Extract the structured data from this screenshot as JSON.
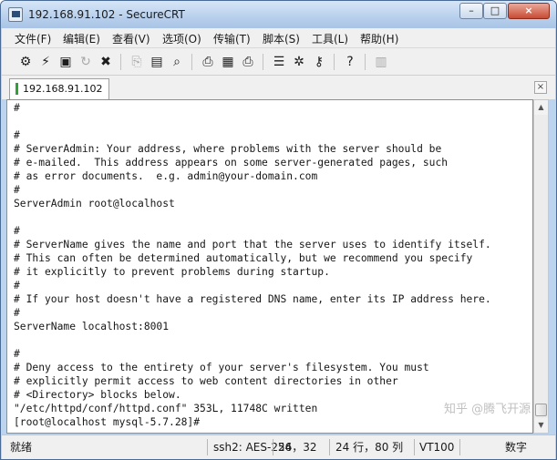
{
  "window": {
    "title": "192.168.91.102 - SecureCRT"
  },
  "menu": [
    "文件(F)",
    "编辑(E)",
    "查看(V)",
    "选项(O)",
    "传输(T)",
    "脚本(S)",
    "工具(L)",
    "帮助(H)"
  ],
  "toolbar": {
    "icons": [
      "connect-icon",
      "quick-connect-icon",
      "connect-tab-icon",
      "reconnect-icon",
      "disconnect-icon",
      "copy-icon",
      "paste-icon",
      "find-icon",
      "print-setup-icon",
      "print-selection-icon",
      "print-icon",
      "session-options-icon",
      "global-options-icon",
      "keymap-icon",
      "help-icon",
      "sftp-icon"
    ]
  },
  "tab": {
    "label": "192.168.91.102",
    "close_glyph": "×"
  },
  "terminal": {
    "lines": [
      "#",
      "",
      "#",
      "# ServerAdmin: Your address, where problems with the server should be",
      "# e-mailed.  This address appears on some server-generated pages, such",
      "# as error documents.  e.g. admin@your-domain.com",
      "#",
      "ServerAdmin root@localhost",
      "",
      "#",
      "# ServerName gives the name and port that the server uses to identify itself.",
      "# This can often be determined automatically, but we recommend you specify",
      "# it explicitly to prevent problems during startup.",
      "#",
      "# If your host doesn't have a registered DNS name, enter its IP address here.",
      "#",
      "ServerName localhost:8001",
      "",
      "#",
      "# Deny access to the entirety of your server's filesystem. You must",
      "# explicitly permit access to web content directories in other",
      "# <Directory> blocks below.",
      "\"/etc/httpd/conf/httpd.conf\" 353L, 11748C written",
      "[root@localhost mysql-5.7.28]#"
    ]
  },
  "status": {
    "ready": "就绪",
    "protocol": "ssh2: AES-256",
    "cursor": "24，32",
    "size": "24 行，80 列",
    "emulation": "VT100",
    "caps": "数字"
  },
  "watermark": "知乎 @腾飞开源"
}
